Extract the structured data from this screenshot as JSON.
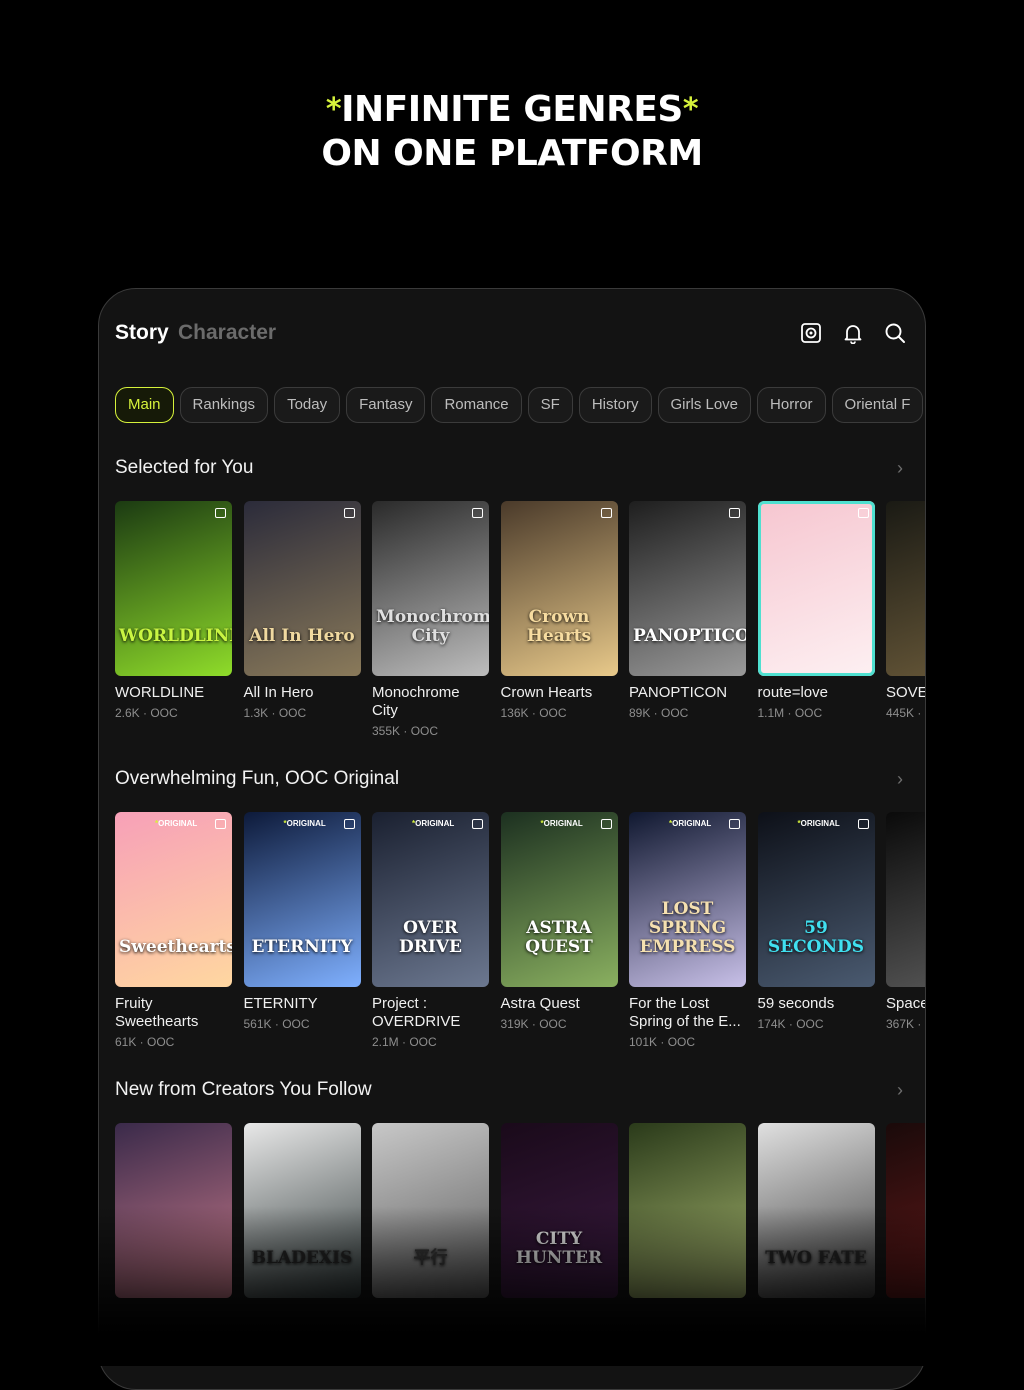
{
  "headline": {
    "line1": "INFINITE GENRES",
    "line2": "ON ONE PLATFORM",
    "star": "*"
  },
  "topbar": {
    "tab_story": "Story",
    "tab_character": "Character",
    "icons": [
      "camera-icon",
      "bell-icon",
      "search-icon"
    ]
  },
  "chips": [
    "Main",
    "Rankings",
    "Today",
    "Fantasy",
    "Romance",
    "SF",
    "History",
    "Girls Love",
    "Horror",
    "Oriental F"
  ],
  "sections": [
    {
      "title": "Selected for You",
      "chevron": "›",
      "items": [
        {
          "title": "WORLDLINE",
          "meta": "2.6K · OOC",
          "cover": "WORLDLINE",
          "c1": "#1b3a12",
          "c2": "#8fdc2a",
          "ccol": "#c9f542"
        },
        {
          "title": "All In Hero",
          "meta": "1.3K · OOC",
          "cover": "All In Hero",
          "c1": "#2b2b3a",
          "c2": "#8a7a5a",
          "ccol": "#f0d9a0"
        },
        {
          "title": "Monochrome City",
          "meta": "355K · OOC",
          "cover": "Monochrome City",
          "c1": "#2a2a2a",
          "c2": "#bdbdbd",
          "ccol": "#e0e0e0"
        },
        {
          "title": "Crown Hearts",
          "meta": "136K · OOC",
          "cover": "Crown Hearts",
          "c1": "#4a3a2a",
          "c2": "#e8c98a",
          "ccol": "#f7dca0"
        },
        {
          "title": "PANOPTICON",
          "meta": "89K · OOC",
          "cover": "PANOPTICON",
          "c1": "#1e1e1e",
          "c2": "#9a9a9a",
          "ccol": "#ffffff"
        },
        {
          "title": "route=love",
          "meta": "1.1M · OOC",
          "cover": "",
          "c1": "#f6c6d0",
          "c2": "#fdf0f2",
          "ccol": "#ffffff"
        },
        {
          "title": "SOVE",
          "meta": "445K ·",
          "cover": "",
          "c1": "#1a1a14",
          "c2": "#6a5a3a",
          "ccol": "#ffffff"
        }
      ]
    },
    {
      "title": "Overwhelming Fun, OOC Original",
      "chevron": "›",
      "items": [
        {
          "title": "Fruity Sweethearts",
          "meta": "61K · OOC",
          "cover": "Sweethearts",
          "c1": "#f7a0b8",
          "c2": "#ffd7a0",
          "ccol": "#ffffff",
          "orig": "ORIGINAL"
        },
        {
          "title": "ETERNITY",
          "meta": "561K · OOC",
          "cover": "ETERNITY",
          "c1": "#0d1a3a",
          "c2": "#7fb0ff",
          "ccol": "#ffffff",
          "orig": "ORIGINAL"
        },
        {
          "title": "Project : OVERDRIVE",
          "meta": "2.1M · OOC",
          "cover": "OVER DRIVE",
          "c1": "#1a2030",
          "c2": "#6c7890",
          "ccol": "#ffffff",
          "orig": "ORIGINAL"
        },
        {
          "title": "Astra Quest",
          "meta": "319K · OOC",
          "cover": "ASTRA QUEST",
          "c1": "#1c3020",
          "c2": "#8ab060",
          "ccol": "#ffffff",
          "orig": "ORIGINAL"
        },
        {
          "title": "For the Lost Spring of the E...",
          "meta": "101K · OOC",
          "cover": "LOST SPRING EMPRESS",
          "c1": "#101830",
          "c2": "#c8c0e8",
          "ccol": "#f5e0b0",
          "orig": "ORIGINAL"
        },
        {
          "title": "59 seconds",
          "meta": "174K · OOC",
          "cover": "59 SECONDS",
          "c1": "#0d1018",
          "c2": "#4a5a70",
          "ccol": "#40e0f0",
          "orig": "ORIGINAL"
        },
        {
          "title": "Space",
          "meta": "367K ·",
          "cover": "",
          "c1": "#0a0a0a",
          "c2": "#5a5a5a",
          "ccol": "#ffffff"
        }
      ]
    },
    {
      "title": "New from Creators You Follow",
      "chevron": "›",
      "items": [
        {
          "title": "",
          "meta": "",
          "cover": "",
          "c1": "#3a2a4a",
          "c2": "#c87a8a",
          "ccol": "#ffffff"
        },
        {
          "title": "",
          "meta": "",
          "cover": "BLADEXIS",
          "c1": "#e8e8e8",
          "c2": "#303a3a",
          "ccol": "#222222"
        },
        {
          "title": "",
          "meta": "",
          "cover": "平行",
          "c1": "#c8c8c8",
          "c2": "#5a5a5a",
          "ccol": "#333333"
        },
        {
          "title": "",
          "meta": "",
          "cover": "CITY HUNTER",
          "c1": "#1a0a1a",
          "c2": "#3a1a40",
          "ccol": "#e0e0e0"
        },
        {
          "title": "",
          "meta": "",
          "cover": "",
          "c1": "#2a3a1a",
          "c2": "#a8b870",
          "ccol": "#ffffff"
        },
        {
          "title": "",
          "meta": "",
          "cover": "TWO FATE",
          "c1": "#e0e0e0",
          "c2": "#3a3a3a",
          "ccol": "#222222"
        },
        {
          "title": "",
          "meta": "",
          "cover": "",
          "c1": "#1a0a0a",
          "c2": "#6a1a1a",
          "ccol": "#ffffff"
        }
      ]
    }
  ]
}
